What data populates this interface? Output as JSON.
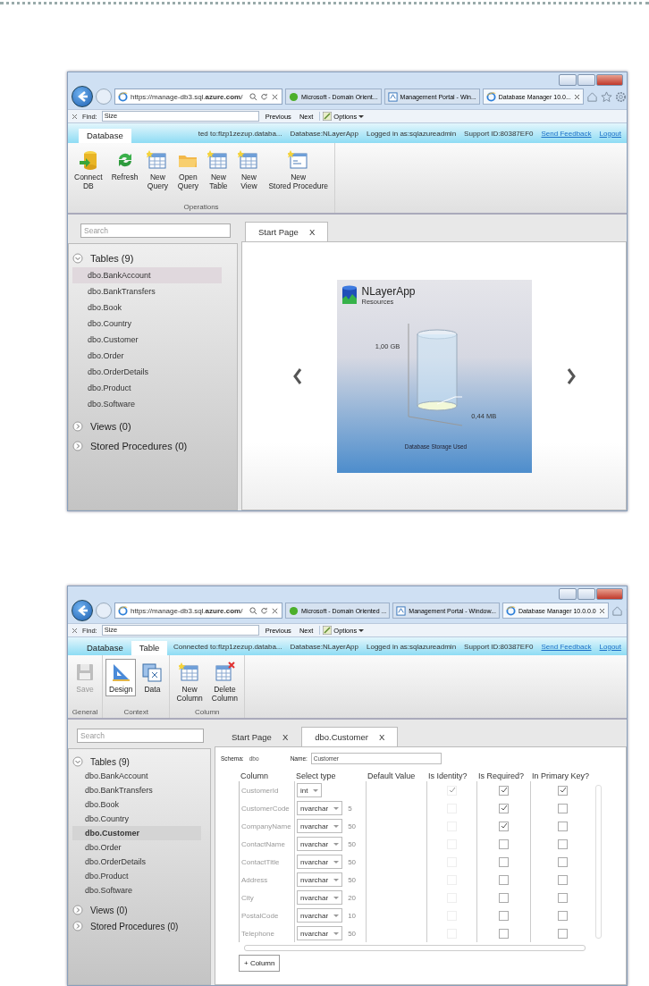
{
  "screenshots": [
    {
      "browser": {
        "url": "https://manage-db3.sql.**azure.com**/",
        "tabs": [
          {
            "label": "Microsoft - Domain Orient...",
            "selected": false
          },
          {
            "label": "Management Portal - Win...",
            "selected": false
          },
          {
            "label": "Database Manager 10.0...",
            "selected": true
          }
        ],
        "find": {
          "label": "Find:",
          "value": "Size",
          "previous": "Previous",
          "next": "Next",
          "options": "Options"
        }
      },
      "header": {
        "ribbon_tabs": [
          {
            "label": "Database",
            "selected": true
          }
        ],
        "status": [
          "ted to:flzp1zezup.databa...",
          "Database:NLayerApp",
          "Logged in as:sqlazureadmin",
          "Support ID:80387EF0"
        ],
        "links": [
          "Send Feedback",
          "Logout"
        ]
      },
      "ribbon": {
        "groups": [
          {
            "label": "Operations",
            "buttons": [
              {
                "label": "Connect\nDB",
                "disabled": false,
                "selected": false
              },
              {
                "label": "Refresh",
                "disabled": false,
                "selected": false
              },
              {
                "label": "New\nQuery",
                "disabled": false,
                "selected": false
              },
              {
                "label": "Open\nQuery",
                "disabled": false,
                "selected": false
              },
              {
                "label": "New\nTable",
                "disabled": false,
                "selected": false
              },
              {
                "label": "New\nView",
                "disabled": false,
                "selected": false
              },
              {
                "label": "New\nStored Procedure",
                "disabled": false,
                "selected": false
              }
            ]
          }
        ]
      },
      "sidebar": {
        "search_placeholder": "Search",
        "sections": [
          {
            "label": "Tables (9)",
            "expanded": true,
            "items": [
              {
                "label": "dbo.BankAccount",
                "selected": true
              },
              {
                "label": "dbo.BankTransfers",
                "selected": false
              },
              {
                "label": "dbo.Book",
                "selected": false
              },
              {
                "label": "dbo.Country",
                "selected": false
              },
              {
                "label": "dbo.Customer",
                "selected": false
              },
              {
                "label": "dbo.Order",
                "selected": false
              },
              {
                "label": "dbo.OrderDetails",
                "selected": false
              },
              {
                "label": "dbo.Product",
                "selected": false
              },
              {
                "label": "dbo.Software",
                "selected": false
              }
            ]
          },
          {
            "label": "Views (0)",
            "expanded": false
          },
          {
            "label": "Stored Procedures (0)",
            "expanded": false
          }
        ]
      },
      "doc_tabs": [
        {
          "label": "Start Page",
          "close": "X",
          "selected": true
        }
      ],
      "content": {
        "kind": "start_page",
        "title": "NLayerApp",
        "subtitle": "Resources",
        "max_label": "1,00 GB",
        "used_label": "0,44 MB",
        "caption": "Database Storage Used"
      }
    },
    {
      "browser": {
        "url": "https://manage-db3.sql.**azure.com**/",
        "tabs": [
          {
            "label": "Microsoft - Domain Oriented ...",
            "selected": false
          },
          {
            "label": "Management Portal - Window...",
            "selected": false
          },
          {
            "label": "Database Manager 10.0.0.0",
            "selected": true
          }
        ],
        "find": {
          "label": "Find:",
          "value": "Size",
          "previous": "Previous",
          "next": "Next",
          "options": "Options"
        }
      },
      "header": {
        "ribbon_tabs": [
          {
            "label": "Database",
            "selected": false
          },
          {
            "label": "Table",
            "selected": true
          }
        ],
        "status": [
          "Connected to:flzp1zezup.databa...",
          "Database:NLayerApp",
          "Logged in as:sqlazureadmin",
          "Support ID:80387EF0"
        ],
        "links": [
          "Send Feedback",
          "Logout"
        ]
      },
      "ribbon": {
        "groups": [
          {
            "label": "General",
            "buttons": [
              {
                "label": "Save",
                "disabled": true,
                "selected": false
              }
            ]
          },
          {
            "label": "Context",
            "buttons": [
              {
                "label": "Design",
                "disabled": false,
                "selected": true
              },
              {
                "label": "Data",
                "disabled": false,
                "selected": false
              }
            ]
          },
          {
            "label": "Column",
            "buttons": [
              {
                "label": "New\nColumn",
                "disabled": false,
                "selected": false
              },
              {
                "label": "Delete\nColumn",
                "disabled": false,
                "selected": false
              }
            ]
          }
        ]
      },
      "sidebar": {
        "search_placeholder": "Search",
        "sections": [
          {
            "label": "Tables (9)",
            "expanded": true,
            "items": [
              {
                "label": "dbo.BankAccount",
                "selected": false
              },
              {
                "label": "dbo.BankTransfers",
                "selected": false
              },
              {
                "label": "dbo.Book",
                "selected": false
              },
              {
                "label": "dbo.Country",
                "selected": false
              },
              {
                "label": "dbo.Customer",
                "selected": true
              },
              {
                "label": "dbo.Order",
                "selected": false
              },
              {
                "label": "dbo.OrderDetails",
                "selected": false
              },
              {
                "label": "dbo.Product",
                "selected": false
              },
              {
                "label": "dbo.Software",
                "selected": false
              }
            ]
          },
          {
            "label": "Views (0)",
            "expanded": false
          },
          {
            "label": "Stored Procedures (0)",
            "expanded": false
          }
        ]
      },
      "doc_tabs": [
        {
          "label": "Start Page",
          "close": "X",
          "selected": false
        },
        {
          "label": "dbo.Customer",
          "close": "X",
          "selected": true
        }
      ],
      "content": {
        "kind": "table_designer",
        "schema_label": "Schema:",
        "schema": "dbo",
        "name_label": "Name:",
        "name": "Customer",
        "headers": [
          "Column",
          "Select type",
          "Default Value",
          "Is Identity?",
          "Is Required?",
          "In Primary Key?"
        ],
        "rows": [
          {
            "name": "CustomerId",
            "type": "int",
            "identity": true,
            "required": true,
            "primary_key": true
          },
          {
            "name": "CustomerCode",
            "type": "nvarchar",
            "size": "5",
            "identity": false,
            "required": true,
            "primary_key": false
          },
          {
            "name": "CompanyName",
            "type": "nvarchar",
            "size": "50",
            "identity": false,
            "required": true,
            "primary_key": false
          },
          {
            "name": "ContactName",
            "type": "nvarchar",
            "size": "50",
            "identity": false,
            "required": false,
            "primary_key": false
          },
          {
            "name": "ContactTitle",
            "type": "nvarchar",
            "size": "50",
            "identity": false,
            "required": false,
            "primary_key": false
          },
          {
            "name": "Address",
            "type": "nvarchar",
            "size": "50",
            "identity": false,
            "required": false,
            "primary_key": false
          },
          {
            "name": "City",
            "type": "nvarchar",
            "size": "20",
            "identity": false,
            "required": false,
            "primary_key": false
          },
          {
            "name": "PostalCode",
            "type": "nvarchar",
            "size": "10",
            "identity": false,
            "required": false,
            "primary_key": false
          },
          {
            "name": "Telephone",
            "type": "nvarchar",
            "size": "50",
            "identity": false,
            "required": false,
            "primary_key": false
          }
        ],
        "add_button": "+ Column"
      }
    }
  ]
}
